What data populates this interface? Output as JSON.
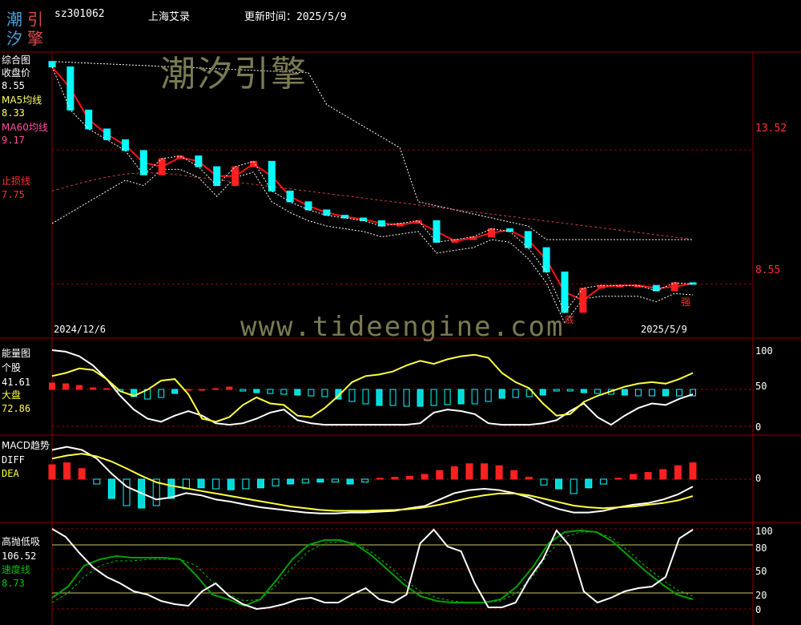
{
  "header": {
    "logo_chars": [
      "潮",
      "引",
      "汐",
      "擎"
    ],
    "code": "sz301062",
    "name": "上海艾录",
    "update_label": "更新时间：2025/5/9"
  },
  "watermark": {
    "brand": "潮汐引擎",
    "url": "www.tideengine.com"
  },
  "colors": {
    "up": "#ff2020",
    "down": "#00ffff",
    "ma5": "#ffffff",
    "ma60": "#ff2020",
    "dea": "#ffff40",
    "speed": "#00a000",
    "grid": "#8b0000",
    "label_red": "#ff3030"
  },
  "panels": {
    "main": {
      "title": "综合图",
      "close_label": "收盘价",
      "close_value": "8.55",
      "ma5_label": "MA5均线",
      "ma5_value": "8.33",
      "ma60_label": "MA60均线",
      "ma60_value": "9.17",
      "stop_label": "止损线",
      "stop_value": "7.75",
      "date_start": "2024/12/6",
      "date_end": "2025/5/9",
      "y_labels": [
        "13.52",
        "8.55"
      ],
      "annot_bottom": "底",
      "annot_strong": "强"
    },
    "energy": {
      "title": "能量图",
      "stock_label": "个股",
      "stock_value": "41.61",
      "market_label": "大盘",
      "market_value": "72.86",
      "y_labels": [
        "100",
        "50",
        "0"
      ]
    },
    "macd": {
      "title": "MACD趋势",
      "diff_label": "DIFF",
      "dea_label": "DEA",
      "y_labels": [
        "0"
      ]
    },
    "kdj": {
      "title": "高抛低吸",
      "value": "106.52",
      "speed_label": "速度线",
      "speed_value": "8.73",
      "y_labels": [
        "100",
        "80",
        "50",
        "20",
        "0"
      ]
    }
  },
  "chart_data": {
    "type": "line",
    "x_range": [
      "2024/12/6",
      "2025/5/9"
    ],
    "candles_close_anchor": [
      16.6,
      15.0,
      14.3,
      13.9,
      13.5,
      12.6,
      13.2,
      13.3,
      12.9,
      12.2,
      12.9,
      13.1,
      12.0,
      11.6,
      11.3,
      11.1,
      11.0,
      10.9,
      10.7,
      10.8,
      10.9,
      10.1,
      10.2,
      10.3,
      10.6,
      10.5,
      9.9,
      9.0,
      7.5,
      8.4,
      8.5,
      8.5,
      8.5,
      8.3,
      8.6,
      8.55
    ],
    "main_ylim": [
      7.2,
      17.0
    ],
    "energy": {
      "ylim": [
        0,
        100
      ],
      "stock": [
        100,
        98,
        92,
        80,
        62,
        40,
        22,
        10,
        6,
        14,
        20,
        14,
        4,
        2,
        4,
        10,
        18,
        22,
        8,
        4,
        2,
        2,
        2,
        2,
        2,
        2,
        2,
        4,
        18,
        22,
        20,
        16,
        4,
        2,
        2,
        2,
        4,
        8,
        20,
        30,
        12,
        2,
        14,
        24,
        30,
        28,
        36,
        42
      ],
      "market": [
        66,
        70,
        76,
        74,
        62,
        46,
        40,
        48,
        60,
        62,
        42,
        10,
        6,
        12,
        28,
        38,
        30,
        28,
        14,
        12,
        24,
        40,
        58,
        66,
        68,
        72,
        80,
        86,
        82,
        88,
        92,
        94,
        90,
        70,
        58,
        50,
        30,
        14,
        16,
        32,
        40,
        46,
        52,
        56,
        58,
        56,
        62,
        70
      ],
      "hist": [
        16,
        14,
        10,
        4,
        2,
        -4,
        -18,
        -24,
        -20,
        -10,
        0,
        0,
        2,
        6,
        -4,
        -8,
        -10,
        -12,
        -14,
        -16,
        -18,
        -24,
        -30,
        -36,
        -40,
        -40,
        -42,
        -42,
        -40,
        -38,
        -36,
        -36,
        -30,
        -22,
        -20,
        -18,
        -14,
        -4,
        -4,
        -8,
        -10,
        -12,
        -14,
        -16,
        -16,
        -16,
        -16,
        -16
      ]
    },
    "macd": {
      "diff": [
        0.55,
        0.62,
        0.55,
        0.35,
        0.0,
        -0.3,
        -0.45,
        -0.6,
        -0.55,
        -0.45,
        -0.5,
        -0.6,
        -0.65,
        -0.72,
        -0.78,
        -0.82,
        -0.86,
        -0.9,
        -0.92,
        -0.92,
        -0.9,
        -0.9,
        -0.88,
        -0.86,
        -0.8,
        -0.75,
        -0.6,
        -0.45,
        -0.38,
        -0.35,
        -0.38,
        -0.45,
        -0.55,
        -0.7,
        -0.82,
        -0.9,
        -0.9,
        -0.86,
        -0.78,
        -0.72,
        -0.68,
        -0.6,
        -0.48,
        -0.3
      ],
      "dea": [
        0.35,
        0.42,
        0.46,
        0.4,
        0.28,
        0.12,
        -0.05,
        -0.2,
        -0.28,
        -0.34,
        -0.4,
        -0.46,
        -0.52,
        -0.58,
        -0.64,
        -0.7,
        -0.76,
        -0.8,
        -0.84,
        -0.86,
        -0.86,
        -0.86,
        -0.85,
        -0.84,
        -0.82,
        -0.78,
        -0.72,
        -0.64,
        -0.56,
        -0.5,
        -0.46,
        -0.46,
        -0.5,
        -0.58,
        -0.66,
        -0.74,
        -0.78,
        -0.8,
        -0.78,
        -0.76,
        -0.72,
        -0.68,
        -0.62,
        -0.52
      ],
      "hist": [
        0.3,
        0.34,
        0.22,
        -0.1,
        -0.4,
        -0.55,
        -0.6,
        -0.55,
        -0.4,
        -0.2,
        -0.18,
        -0.2,
        -0.22,
        -0.2,
        -0.18,
        -0.14,
        -0.1,
        -0.08,
        -0.06,
        -0.06,
        -0.1,
        -0.06,
        0.02,
        0.04,
        0.06,
        0.1,
        0.18,
        0.26,
        0.32,
        0.32,
        0.28,
        0.18,
        0.04,
        -0.12,
        -0.2,
        -0.3,
        -0.18,
        -0.1,
        0.02,
        0.1,
        0.14,
        0.2,
        0.28,
        0.34
      ],
      "ylim": [
        -1.0,
        0.8
      ]
    },
    "kdj": {
      "ylim": [
        0,
        100
      ],
      "white": [
        100,
        90,
        70,
        52,
        40,
        32,
        22,
        18,
        10,
        6,
        4,
        22,
        32,
        16,
        6,
        0,
        2,
        6,
        12,
        14,
        8,
        8,
        18,
        26,
        12,
        8,
        18,
        82,
        99,
        78,
        72,
        32,
        2,
        2,
        8,
        38,
        62,
        98,
        78,
        22,
        8,
        14,
        22,
        26,
        28,
        40,
        88,
        99
      ],
      "speed": [
        14,
        28,
        54,
        62,
        66,
        64,
        64,
        64,
        62,
        42,
        18,
        12,
        4,
        12,
        36,
        62,
        80,
        86,
        86,
        80,
        66,
        48,
        30,
        16,
        10,
        8,
        8,
        8,
        12,
        28,
        52,
        82,
        96,
        98,
        96,
        84,
        66,
        48,
        32,
        18,
        12
      ],
      "speed_dash": [
        8,
        20,
        40,
        54,
        60,
        60,
        62,
        62,
        62,
        54,
        34,
        18,
        10,
        12,
        30,
        52,
        72,
        82,
        84,
        82,
        70,
        54,
        36,
        22,
        14,
        10,
        8,
        8,
        10,
        20,
        40,
        70,
        90,
        96,
        96,
        88,
        72,
        54,
        38,
        24,
        16
      ]
    }
  }
}
